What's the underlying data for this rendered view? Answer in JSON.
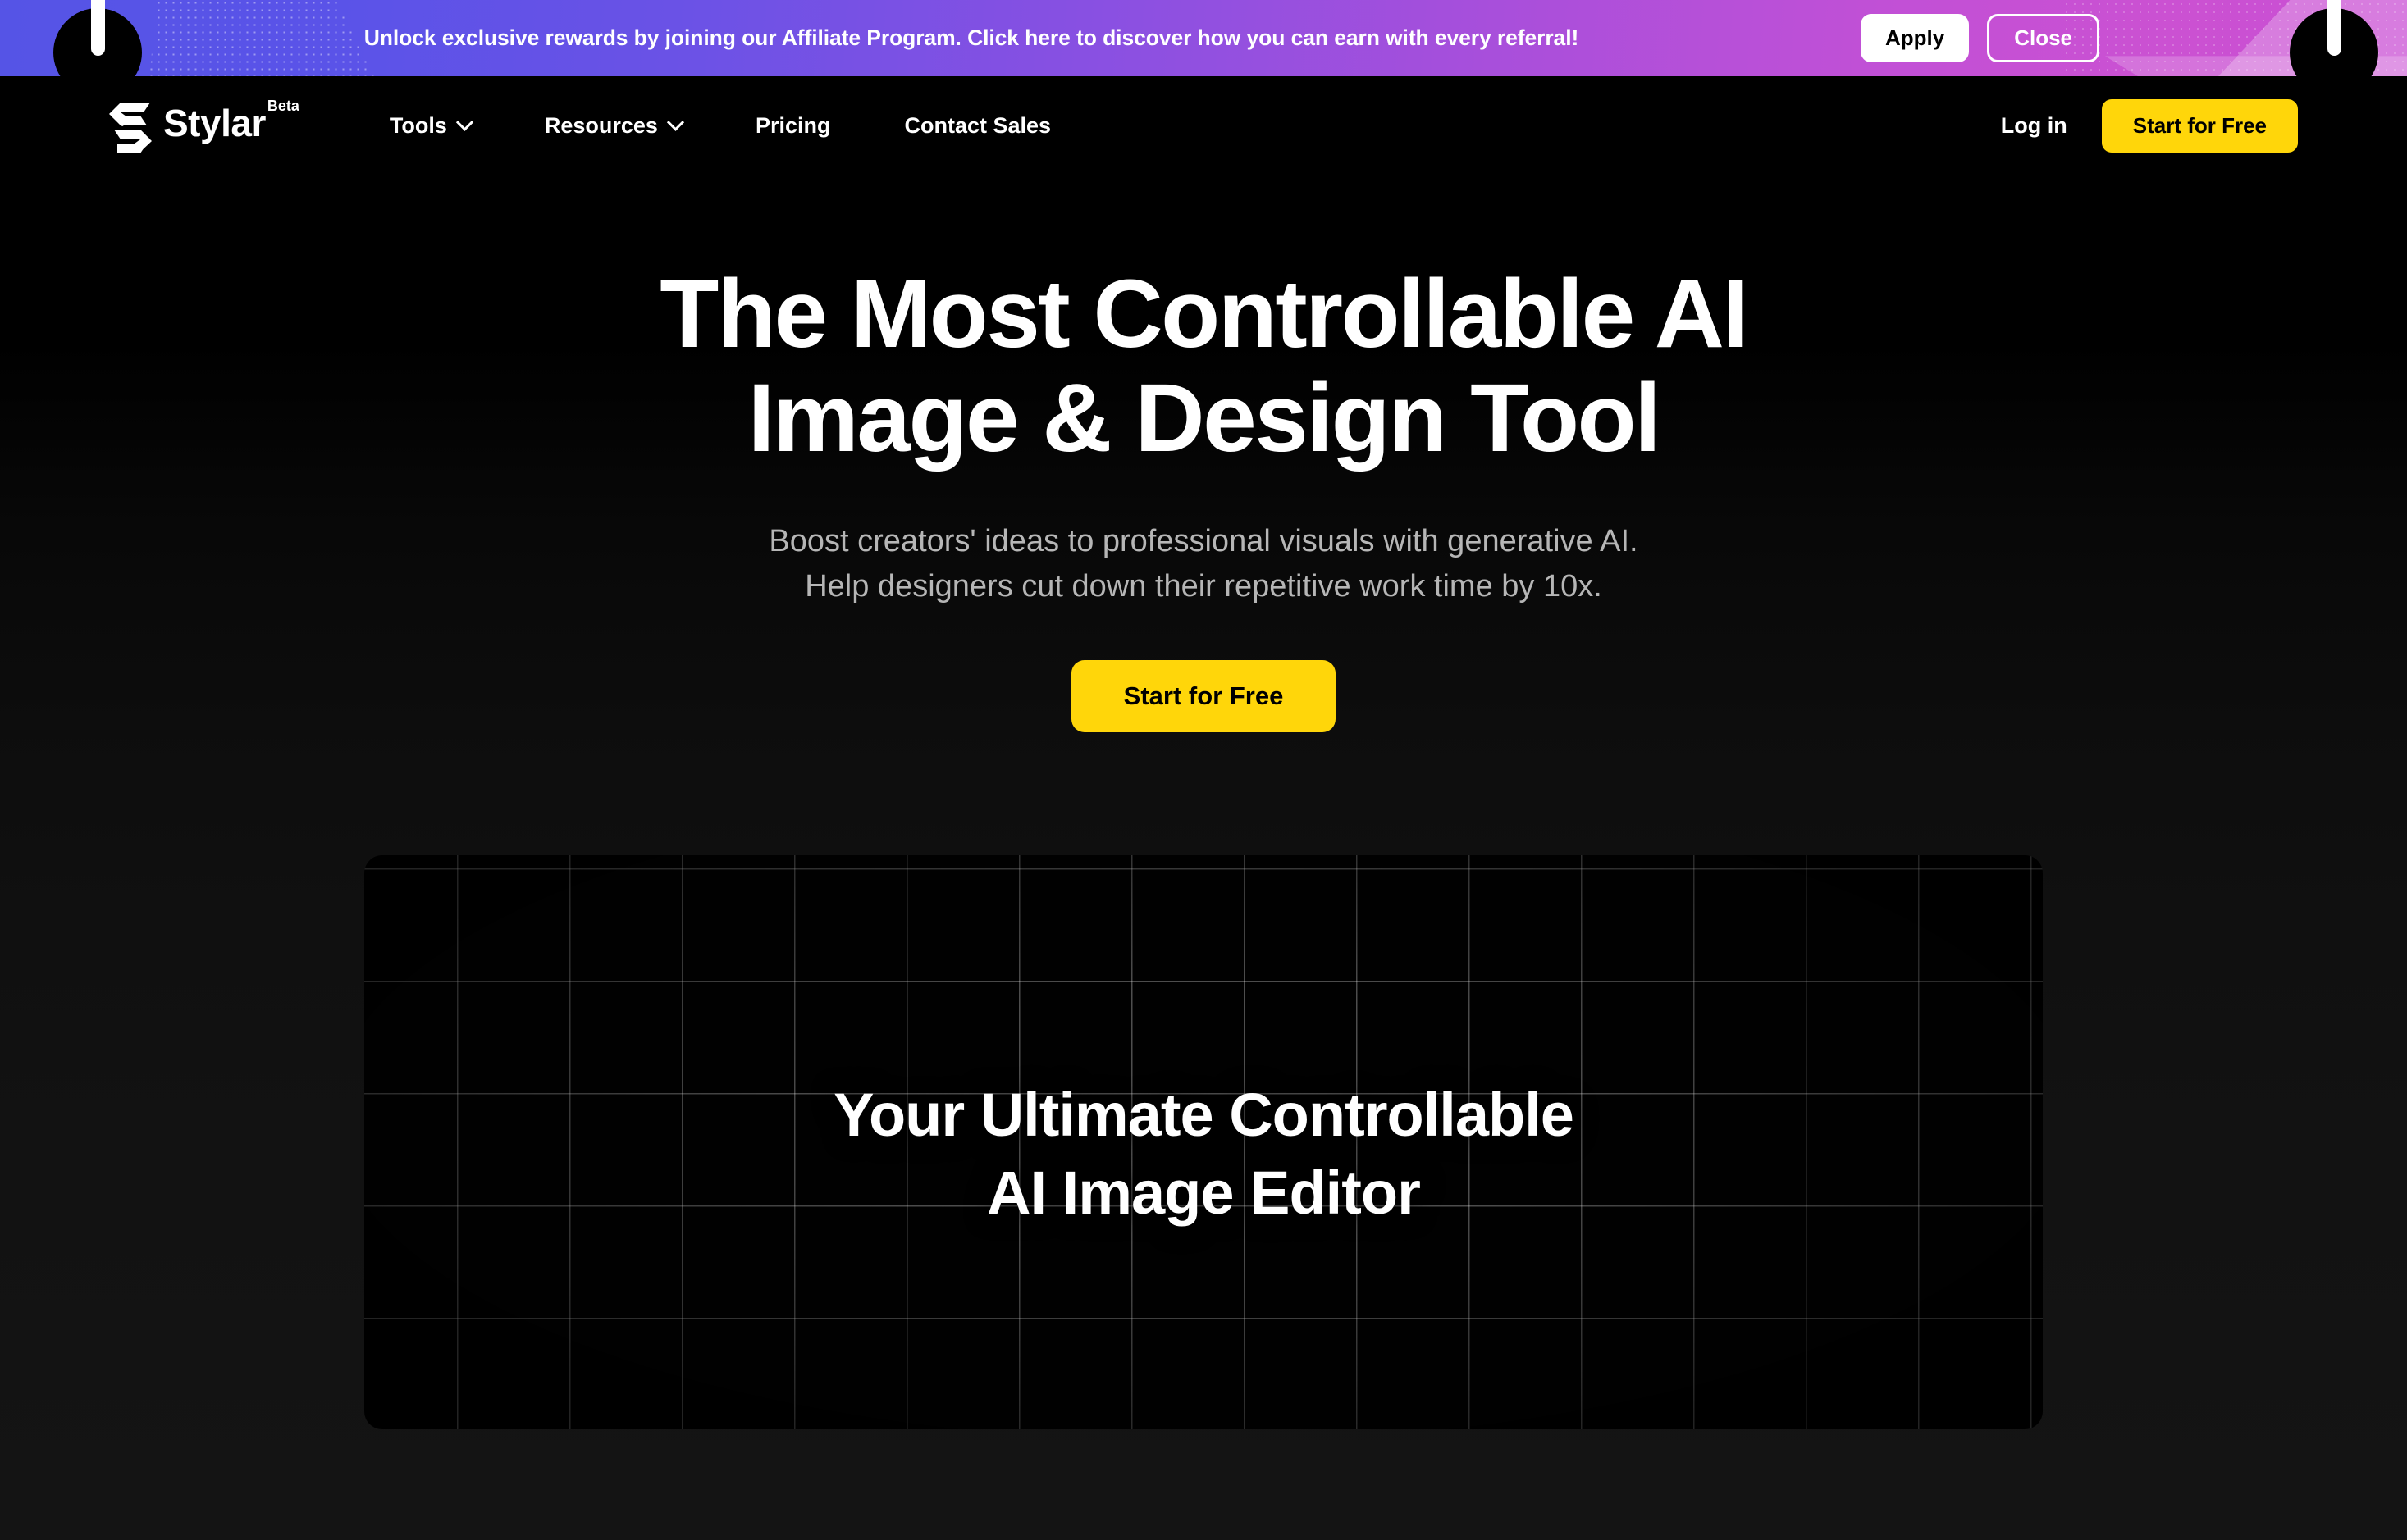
{
  "promo": {
    "message": "Unlock exclusive rewards by joining our Affiliate Program. Click here to discover how you can earn with every referral!",
    "apply_label": "Apply",
    "close_label": "Close",
    "gradient_start": "#5554e6",
    "gradient_end": "#c94fd4"
  },
  "nav": {
    "brand_name": "Stylar",
    "brand_badge": "Beta",
    "links": [
      {
        "label": "Tools",
        "has_dropdown": true
      },
      {
        "label": "Resources",
        "has_dropdown": true
      },
      {
        "label": "Pricing",
        "has_dropdown": false
      },
      {
        "label": "Contact Sales",
        "has_dropdown": false
      }
    ],
    "login_label": "Log in",
    "cta_label": "Start for Free",
    "cta_color": "#FFD60A"
  },
  "hero": {
    "title_line1": "The Most Controllable AI",
    "title_line2": "Image & Design Tool",
    "subtitle_line1": "Boost creators' ideas to professional visuals with generative AI.",
    "subtitle_line2": "Help designers cut down their repetitive work time by 10x.",
    "cta_label": "Start for Free"
  },
  "showcase": {
    "caption_line1": "Your Ultimate Controllable",
    "caption_line2": "AI Image Editor"
  }
}
